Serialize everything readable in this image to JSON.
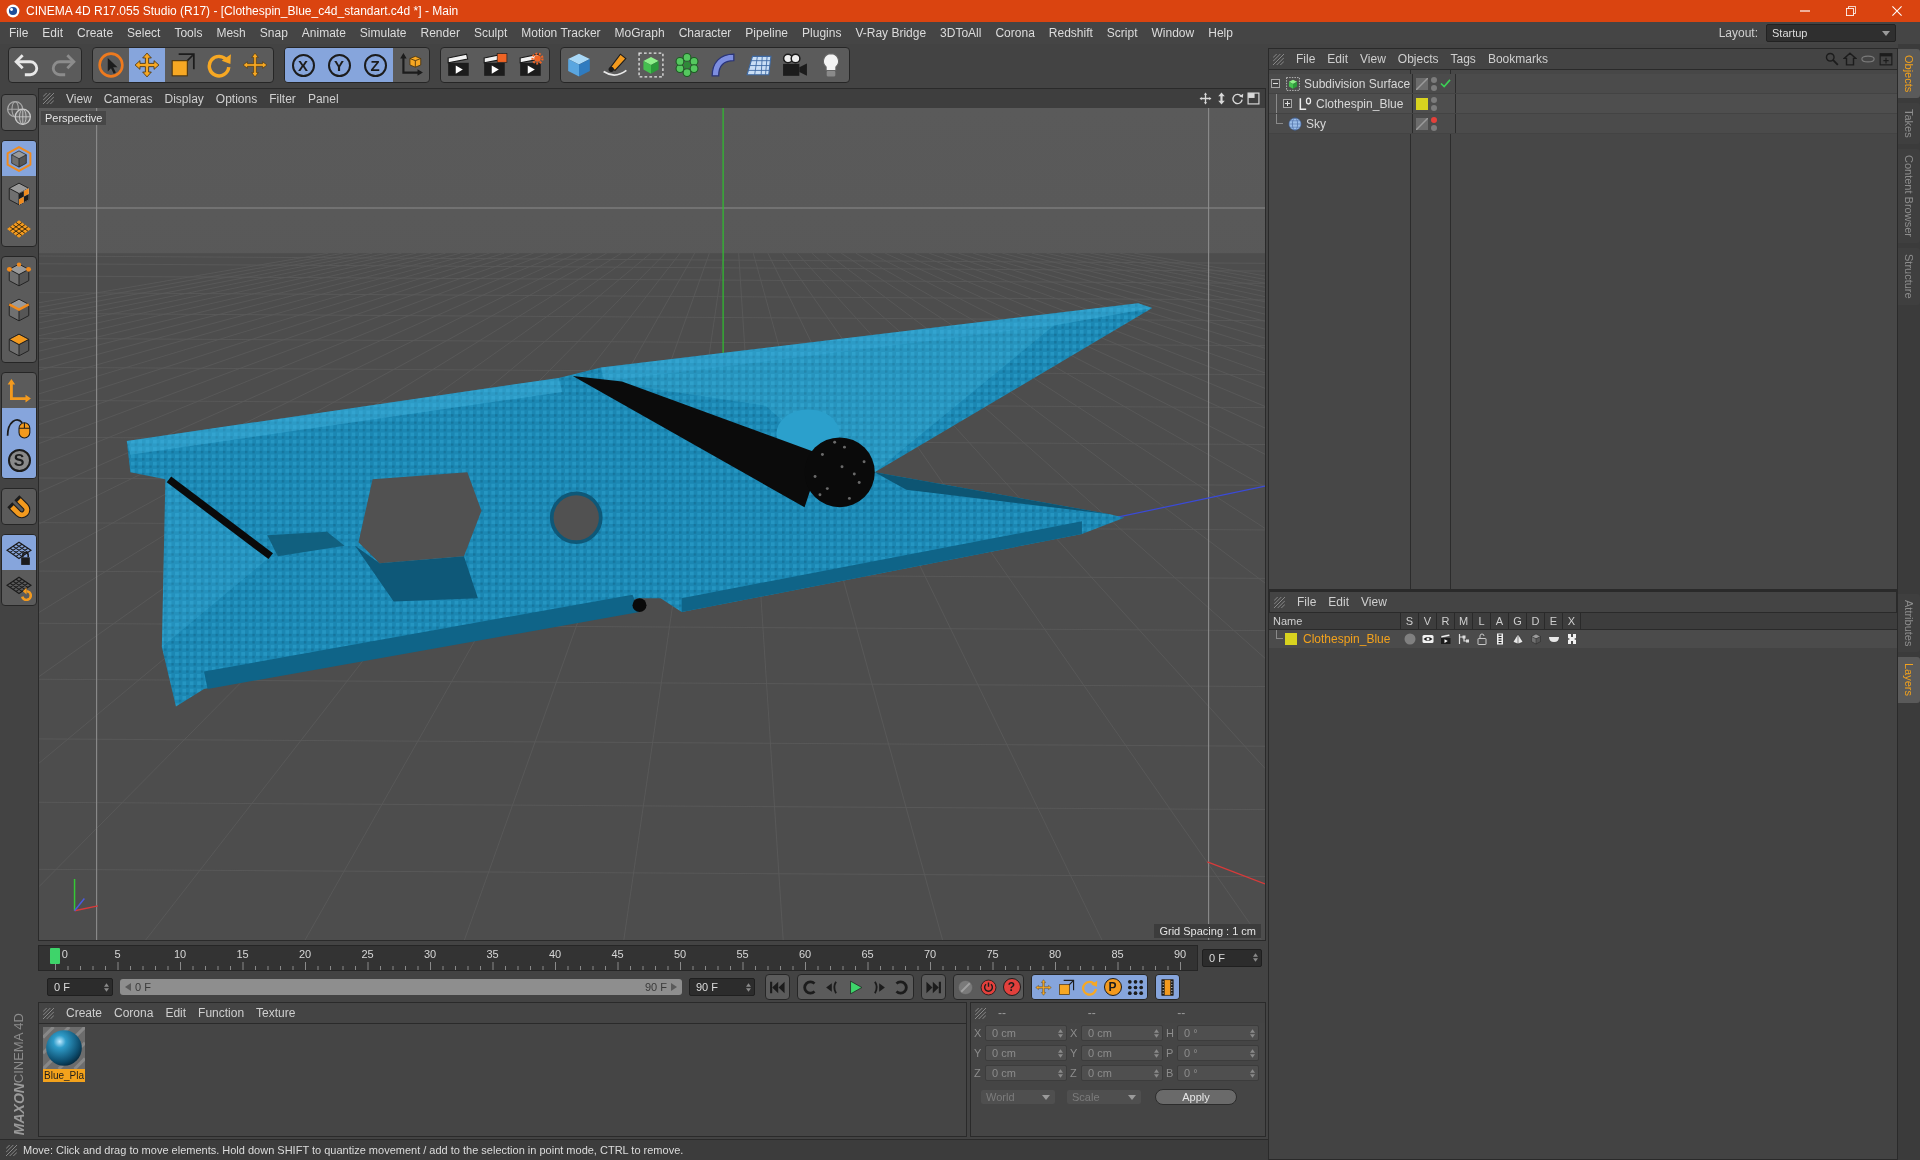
{
  "window": {
    "title": "CINEMA 4D R17.055 Studio (R17) - [Clothespin_Blue_c4d_standart.c4d *] - Main",
    "controls": [
      {
        "kind": "minimize"
      },
      {
        "kind": "restore"
      },
      {
        "kind": "close"
      }
    ]
  },
  "menu": [
    "File",
    "Edit",
    "Create",
    "Select",
    "Tools",
    "Mesh",
    "Snap",
    "Animate",
    "Simulate",
    "Render",
    "Sculpt",
    "Motion Tracker",
    "MoGraph",
    "Character",
    "Pipeline",
    "Plugins",
    "V-Ray Bridge",
    "3DToAll",
    "Corona",
    "Redshift",
    "Script",
    "Window",
    "Help"
  ],
  "layout": {
    "label": "Layout:",
    "value": "Startup"
  },
  "toolbar": [
    [
      {
        "kind": "undo",
        "active": false,
        "disabled": false
      },
      {
        "kind": "redo",
        "active": false,
        "disabled": true
      }
    ],
    [
      {
        "kind": "select",
        "active": false,
        "disabled": false
      },
      {
        "kind": "move",
        "active": true,
        "disabled": false
      },
      {
        "kind": "scale",
        "active": false,
        "disabled": false
      },
      {
        "kind": "rotate",
        "active": false,
        "disabled": false
      },
      {
        "kind": "recent-tool",
        "active": false,
        "disabled": false
      }
    ],
    [
      {
        "kind": "axis-lock",
        "label": "X",
        "active": true,
        "disabled": false
      },
      {
        "kind": "axis-lock",
        "label": "Y",
        "active": true,
        "disabled": false
      },
      {
        "kind": "axis-lock",
        "label": "Z",
        "active": true,
        "disabled": false
      },
      {
        "kind": "coord-system",
        "active": false,
        "disabled": false
      }
    ],
    [
      {
        "kind": "render-view",
        "active": false,
        "disabled": false
      },
      {
        "kind": "render-picture",
        "active": false,
        "disabled": false
      },
      {
        "kind": "render-settings",
        "active": false,
        "disabled": false
      }
    ],
    [
      {
        "kind": "cube",
        "active": false,
        "disabled": false
      },
      {
        "kind": "pen",
        "active": false,
        "disabled": false
      },
      {
        "kind": "subdivision",
        "active": false,
        "disabled": false
      },
      {
        "kind": "cloner",
        "active": false,
        "disabled": false
      },
      {
        "kind": "bend",
        "active": false,
        "disabled": false
      },
      {
        "kind": "floor",
        "active": false,
        "disabled": false
      },
      {
        "kind": "camera",
        "active": false,
        "disabled": false
      },
      {
        "kind": "light",
        "active": false,
        "disabled": false
      }
    ]
  ],
  "left_tools": [
    [
      {
        "kind": "make-editable",
        "active": false
      }
    ],
    [
      {
        "kind": "model",
        "active": true
      },
      {
        "kind": "texture",
        "active": false
      },
      {
        "kind": "workplane",
        "active": false
      }
    ],
    [
      {
        "kind": "points",
        "active": false
      },
      {
        "kind": "edges",
        "active": false
      },
      {
        "kind": "polygons",
        "active": false
      }
    ],
    [
      {
        "kind": "axis-mode",
        "active": false
      },
      {
        "kind": "tweak",
        "active": true
      },
      {
        "kind": "snap",
        "label": "S",
        "active": true
      }
    ],
    [
      {
        "kind": "magnet",
        "active": false
      }
    ],
    [
      {
        "kind": "grid-lock",
        "active": true
      },
      {
        "kind": "grid-rotate",
        "active": false
      }
    ]
  ],
  "logo": {
    "brand": "MAXON",
    "product": "CINEMA 4D"
  },
  "viewport": {
    "menu": [
      "View",
      "Cameras",
      "Display",
      "Options",
      "Filter",
      "Panel"
    ],
    "nav": [
      {
        "kind": "pan"
      },
      {
        "kind": "dolly"
      },
      {
        "kind": "orbit"
      },
      {
        "kind": "maximize"
      }
    ],
    "camera": "Perspective",
    "grid_spacing": "Grid Spacing : 1 cm"
  },
  "timeline": {
    "labels": [
      "0",
      "5",
      "10",
      "15",
      "20",
      "25",
      "30",
      "35",
      "40",
      "45",
      "50",
      "55",
      "60",
      "65",
      "70",
      "75",
      "80",
      "85",
      "90"
    ],
    "playhead": {
      "level": 0
    },
    "current_frame": "0 F",
    "start": "0 F",
    "range": {
      "start": "0 F",
      "end": "90 F"
    },
    "end": "90 F",
    "transport": [
      [
        {
          "kind": "go-start",
          "active": false
        }
      ],
      [
        {
          "kind": "prev-key",
          "active": false
        },
        {
          "kind": "prev-frame",
          "active": false
        },
        {
          "kind": "play",
          "active": false
        },
        {
          "kind": "next-frame",
          "active": false
        },
        {
          "kind": "next-key",
          "active": false
        }
      ],
      [
        {
          "kind": "go-end",
          "active": false
        }
      ],
      [
        {
          "kind": "autokey",
          "active": false
        },
        {
          "kind": "record",
          "active": false
        },
        {
          "kind": "key-selection",
          "label": "?",
          "active": false
        }
      ],
      [
        {
          "kind": "key-position",
          "active": true
        },
        {
          "kind": "key-scale",
          "active": true
        },
        {
          "kind": "key-rotation",
          "active": true
        },
        {
          "kind": "key-parameter",
          "label": "P",
          "active": true
        },
        {
          "kind": "key-pla",
          "active": true
        }
      ],
      [
        {
          "kind": "timeline-window",
          "active": true
        }
      ]
    ]
  },
  "materials": {
    "menu": [
      "Create",
      "Corona",
      "Edit",
      "Function",
      "Texture"
    ],
    "items": [
      {
        "name": "Blue_Pla",
        "selected": true
      }
    ]
  },
  "coordinates": {
    "disabled": true,
    "headers": [
      "--",
      "--",
      "--"
    ],
    "rows": [
      {
        "axis": "X",
        "position": "0 cm",
        "size_axis": "X",
        "size": "0 cm",
        "rotation_axis": "H",
        "rotation": "0 °"
      },
      {
        "axis": "Y",
        "position": "0 cm",
        "size_axis": "Y",
        "size": "0 cm",
        "rotation_axis": "P",
        "rotation": "0 °"
      },
      {
        "axis": "Z",
        "position": "0 cm",
        "size_axis": "Z",
        "size": "0 cm",
        "rotation_axis": "B",
        "rotation": "0 °"
      }
    ],
    "mode": "World",
    "size_mode": "Scale",
    "apply": "Apply"
  },
  "status": "Move: Click and drag to move elements. Hold down SHIFT to quantize movement / add to the selection in point mode, CTRL to remove.",
  "objects": {
    "menu": [
      "File",
      "Edit",
      "View",
      "Objects",
      "Tags",
      "Bookmarks"
    ],
    "tools": [
      {
        "kind": "search"
      },
      {
        "kind": "home"
      },
      {
        "kind": "display-filter"
      },
      {
        "kind": "new-window"
      }
    ],
    "tree": [
      {
        "name": "Subdivision Surface",
        "kind": "subdivision",
        "expanded": true,
        "hidden_in_editor": false,
        "hidden_in_render": false,
        "check": true,
        "children": [
          {
            "name": "Clothespin_Blue",
            "kind": "null",
            "expanded": false,
            "color": "#d8d31f",
            "hidden_in_editor": false,
            "hidden_in_render": false,
            "check": false
          }
        ]
      },
      {
        "name": "Sky",
        "kind": "sky",
        "hidden_in_editor": true,
        "hidden_in_render": false,
        "check": false
      }
    ]
  },
  "layers": {
    "menu": [
      "File",
      "Edit",
      "View"
    ],
    "columns": [
      "Name",
      "S",
      "V",
      "R",
      "M",
      "L",
      "A",
      "G",
      "D",
      "E",
      "X"
    ],
    "rows": [
      {
        "name": "Clothespin_Blue",
        "color": "#d8d31f",
        "selected": true,
        "switches": [
          {
            "kind": "solo",
            "on": false
          },
          {
            "kind": "view",
            "on": true
          },
          {
            "kind": "render",
            "on": true
          },
          {
            "kind": "manager",
            "on": true
          },
          {
            "kind": "lock",
            "on": false
          },
          {
            "kind": "animation",
            "on": true
          },
          {
            "kind": "generators",
            "on": true
          },
          {
            "kind": "deformers",
            "on": true
          },
          {
            "kind": "expressions",
            "on": true
          },
          {
            "kind": "xref",
            "on": true
          }
        ]
      }
    ]
  },
  "side_tabs": {
    "upper": [
      {
        "label": "Objects",
        "selected": true
      },
      {
        "label": "Takes",
        "selected": false
      },
      {
        "label": "Content Browser",
        "selected": false
      },
      {
        "label": "Structure",
        "selected": false
      }
    ],
    "lower": [
      {
        "label": "Attributes",
        "selected": false
      },
      {
        "label": "Layers",
        "selected": true
      }
    ]
  }
}
